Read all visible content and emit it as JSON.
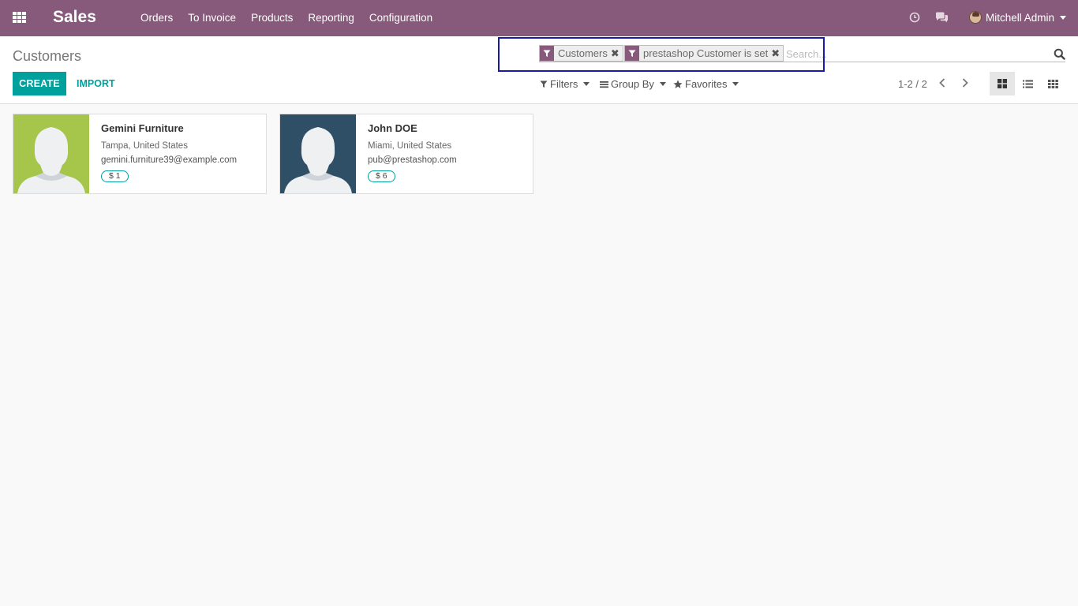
{
  "navbar": {
    "app_name": "Sales",
    "menu": [
      "Orders",
      "To Invoice",
      "Products",
      "Reporting",
      "Configuration"
    ],
    "user_name": "Mitchell Admin",
    "icons": [
      "apps-grid-icon",
      "clock-icon",
      "chat-icon"
    ],
    "color": "#875a7b"
  },
  "control_panel": {
    "title": "Customers",
    "create_label": "CREATE",
    "import_label": "IMPORT",
    "search": {
      "facets": [
        {
          "label": "Customers",
          "icon": "filter-icon"
        },
        {
          "label": "prestashop Customer is set",
          "icon": "filter-icon"
        }
      ],
      "placeholder": "Search..."
    },
    "filters_label": "Filters",
    "groupby_label": "Group By",
    "favorites_label": "Favorites",
    "pager": "1-2 / 2",
    "views": [
      "kanban",
      "list",
      "grid"
    ],
    "active_view": "kanban",
    "accent": "#00a09d"
  },
  "customers": [
    {
      "name": "Gemini Furniture",
      "location": "Tampa, United States",
      "email": "gemini.furniture39@example.com",
      "badge": "$ 1",
      "avatar_bg": "#a6c54b"
    },
    {
      "name": "John DOE",
      "location": "Miami, United States",
      "email": "pub@prestashop.com",
      "badge": "$ 6",
      "avatar_bg": "#2f4f66"
    }
  ]
}
